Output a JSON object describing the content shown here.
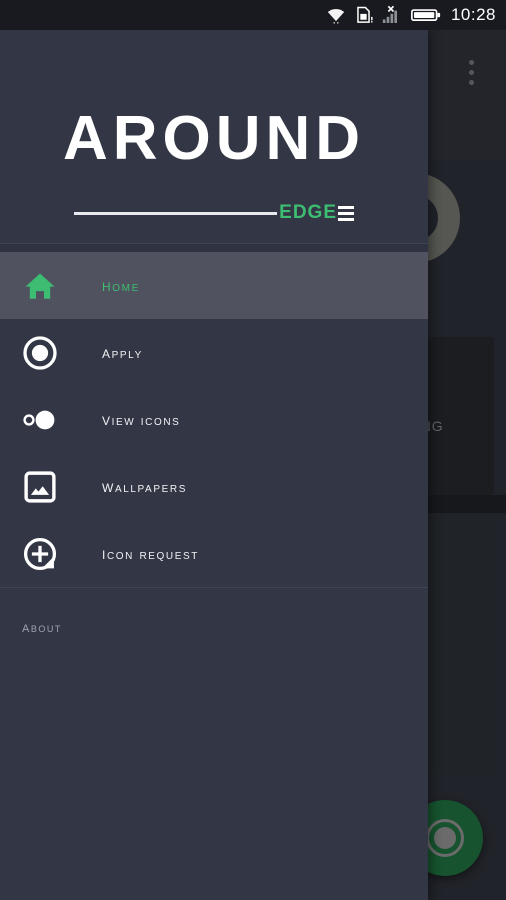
{
  "status_bar": {
    "icons": [
      "wifi-icon",
      "sim-card-alert-icon",
      "signal-no-service-icon",
      "battery-icon"
    ],
    "clock": "10:28"
  },
  "background_app": {
    "overflow_menu_label": "overflow-menu-icon",
    "card_text": "LONG",
    "fab_label": "apply-icon-pack-fab"
  },
  "drawer": {
    "header": {
      "logo_word": "AROUND",
      "logo_accent": "EDGE",
      "bars_icon": "three-bars-icon"
    },
    "items": [
      {
        "id": "home",
        "label": "Home",
        "icon": "home-icon",
        "selected": true
      },
      {
        "id": "apply",
        "label": "Apply",
        "icon": "radio-circle-icon",
        "selected": false
      },
      {
        "id": "view-icons",
        "label": "View Icons",
        "icon": "two-circles-icon",
        "selected": false
      },
      {
        "id": "wallpapers",
        "label": "Wallpapers",
        "icon": "image-icon",
        "selected": false
      },
      {
        "id": "icon-request",
        "label": "Icon Request",
        "icon": "plus-circle-icon",
        "selected": false
      }
    ],
    "sections": [
      {
        "id": "about",
        "label": "About"
      }
    ]
  },
  "colors": {
    "drawer_bg": "#333745",
    "drawer_selected_bg": "#50535f",
    "accent_green": "#3dbd71",
    "fab_green": "#1d6b3b",
    "app_bg": "#2a2d35",
    "status_bar_bg": "#181a1f",
    "label_text": "#f2f3f6",
    "muted_text": "#9ea3b4"
  }
}
